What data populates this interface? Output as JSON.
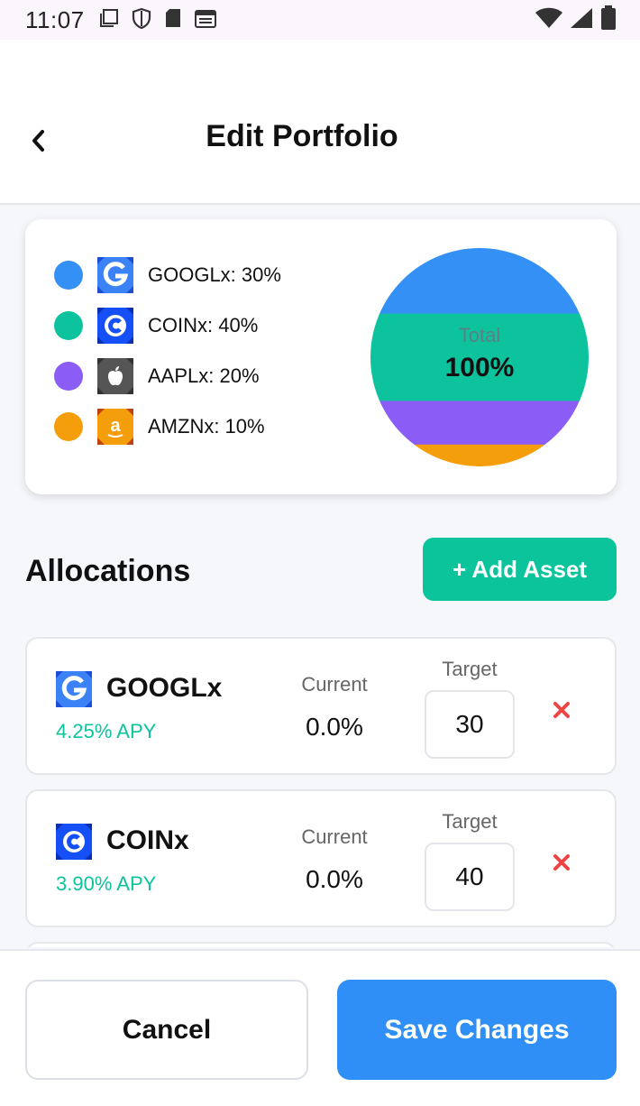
{
  "status_bar": {
    "time": "11:07",
    "icons": [
      "screen-icon",
      "shield-icon",
      "sim-card-icon",
      "calendar-icon",
      "wifi-icon",
      "signal-icon",
      "battery-icon"
    ]
  },
  "header": {
    "title": "Edit Portfolio",
    "back_icon": "chevron-left-icon"
  },
  "portfolio": {
    "legend": [
      {
        "symbol": "GOOGLx",
        "percent": 30,
        "label": "GOOGLx: 30%",
        "color": "#3490f5",
        "logo_color": "#3b82f6",
        "icon": "google-g-icon"
      },
      {
        "symbol": "COINx",
        "percent": 40,
        "label": "COINx: 40%",
        "color": "#0cc39d",
        "logo_color": "#1450f5",
        "icon": "coinbase-c-icon"
      },
      {
        "symbol": "AAPLx",
        "percent": 20,
        "label": "AAPLx: 20%",
        "color": "#8b5cf6",
        "logo_color": "#555555",
        "icon": "apple-icon"
      },
      {
        "symbol": "AMZNx",
        "percent": 10,
        "label": "AMZNx: 10%",
        "color": "#f59e0b",
        "logo_color": "#f59e0b",
        "icon": "amazon-a-icon"
      }
    ],
    "total_label": "Total",
    "total_value": "100%"
  },
  "allocations": {
    "title": "Allocations",
    "add_button_label": "+ Add Asset",
    "current_label": "Current",
    "target_label": "Target",
    "assets": [
      {
        "name": "GOOGLx",
        "apy": "4.25% APY",
        "current": "0.0%",
        "target": "30",
        "icon": "google-g-icon",
        "logo_color": "#3b82f6"
      },
      {
        "name": "COINx",
        "apy": "3.90% APY",
        "current": "0.0%",
        "target": "40",
        "icon": "coinbase-c-icon",
        "logo_color": "#1450f5"
      }
    ],
    "remove_icon": "close-icon",
    "remove_color": "#ef4444"
  },
  "footer": {
    "cancel_label": "Cancel",
    "save_label": "Save Changes"
  }
}
